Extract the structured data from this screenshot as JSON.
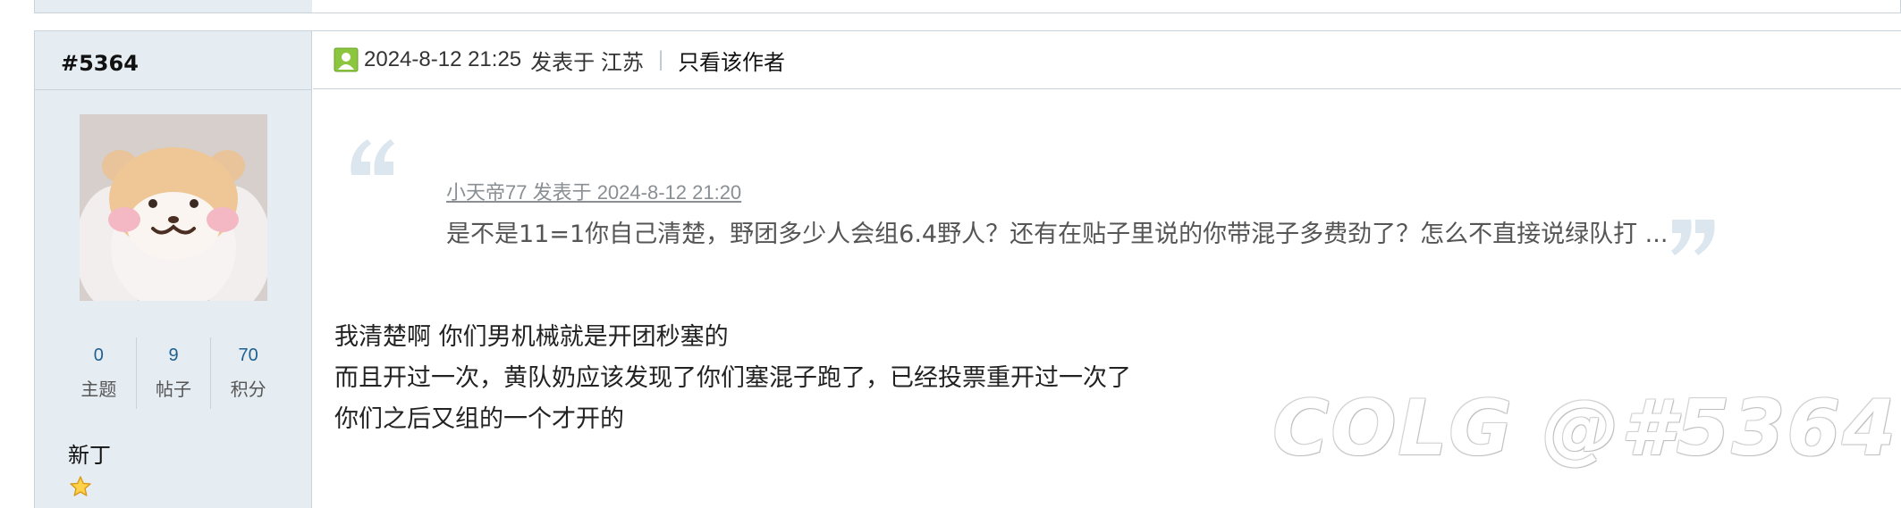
{
  "post": {
    "number": "#5364",
    "author": {
      "stats": [
        {
          "value": "0",
          "label": "主题"
        },
        {
          "value": "9",
          "label": "帖子"
        },
        {
          "value": "70",
          "label": "积分"
        }
      ],
      "rank": "新丁"
    },
    "meta": {
      "datetime": "2024-8-12 21:25",
      "posted_from": "发表于 江苏",
      "separator": "|",
      "only_author_link": "只看该作者"
    },
    "quote": {
      "attribution": "小天帝77 发表于 2024-8-12 21:20",
      "text": "是不是11=1你自己清楚，野团多少人会组6.4野人？还有在贴子里说的你带混子多费劲了？怎么不直接说绿队打 ..."
    },
    "body": [
      "我清楚啊 你们男机械就是开团秒塞的",
      "而且开过一次，黄队奶应该发现了你们塞混子跑了，已经投票重开过一次了",
      "你们之后又组的一个才开的"
    ],
    "watermark": "COLG @#5364"
  },
  "colors": {
    "sidebar_bg": "#e5edf2",
    "border": "#c9d3dc",
    "stat_value": "#1f5f8f",
    "quote_mark": "#dbe6ef"
  },
  "icons": {
    "online": "user-online-icon",
    "rank": "star-icon",
    "quote_open": "open-quote-icon",
    "quote_close": "close-quote-icon"
  }
}
